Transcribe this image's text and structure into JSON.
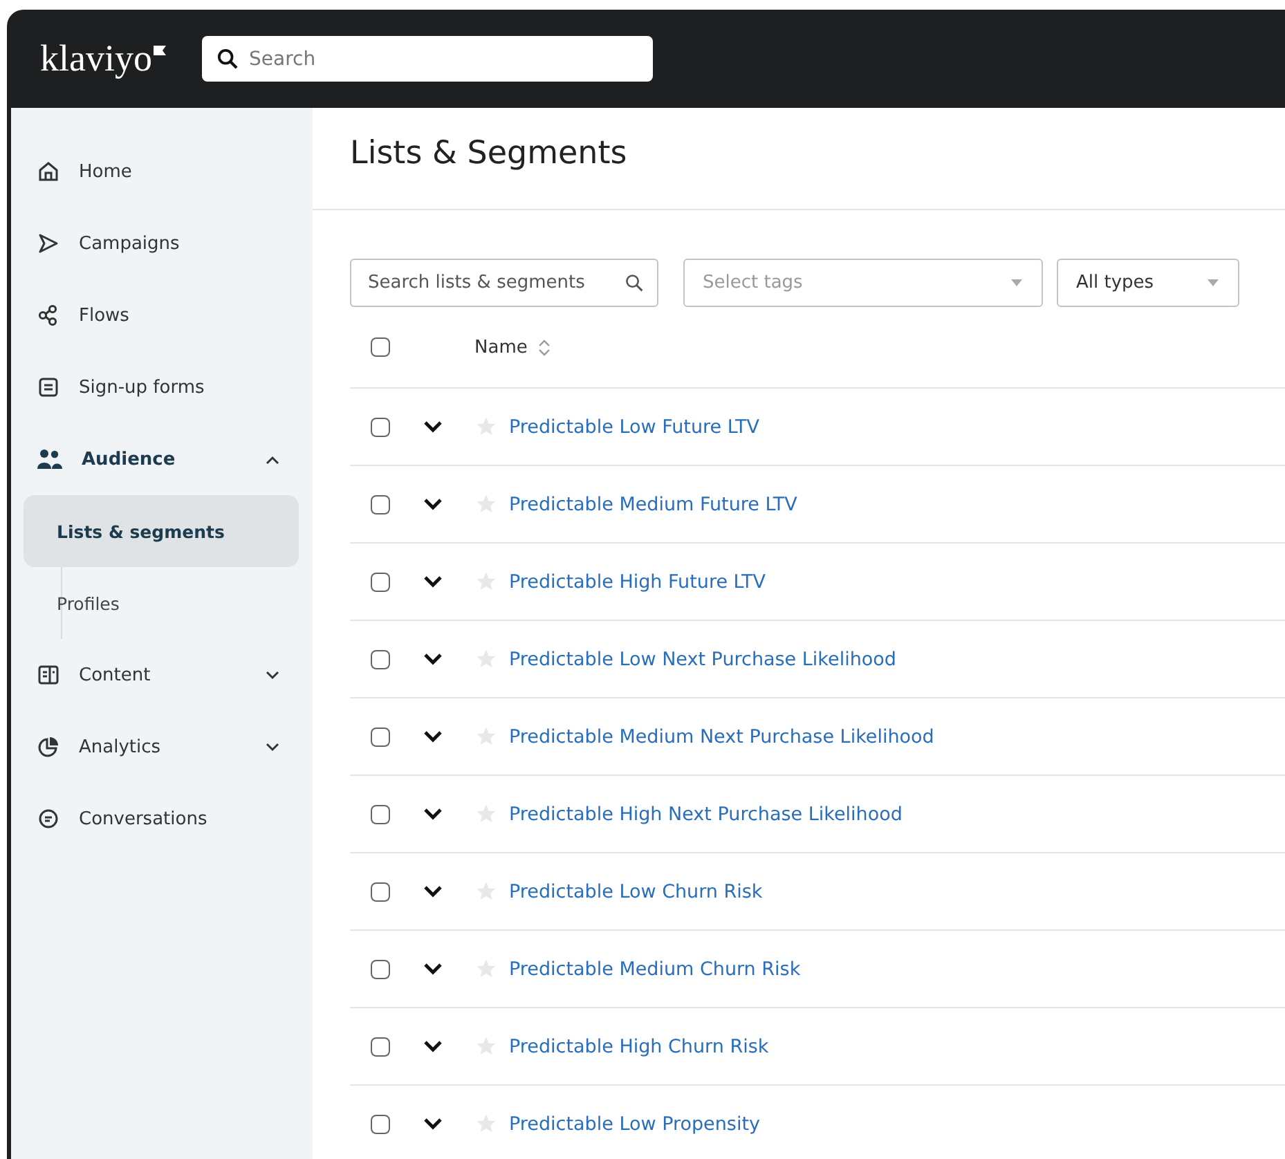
{
  "topbar": {
    "logo": "klaviyo",
    "search": {
      "placeholder": "Search"
    }
  },
  "sidebar": {
    "items": [
      {
        "label": "Home",
        "selected": false
      },
      {
        "label": "Campaigns",
        "selected": false
      },
      {
        "label": "Flows",
        "selected": false
      },
      {
        "label": "Sign-up forms",
        "selected": false
      },
      {
        "label": "Audience",
        "selected": true,
        "expanded": true,
        "children": [
          {
            "label": "Lists & segments",
            "selected": true
          },
          {
            "label": "Profiles",
            "selected": false
          }
        ]
      },
      {
        "label": "Content",
        "selected": false,
        "expanded": false
      },
      {
        "label": "Analytics",
        "selected": false,
        "expanded": false
      },
      {
        "label": "Conversations",
        "selected": false
      }
    ]
  },
  "page": {
    "title": "Lists & Segments"
  },
  "filters": {
    "search": {
      "placeholder": "Search lists & segments"
    },
    "tags": {
      "placeholder": "Select tags"
    },
    "type": {
      "value": "All types"
    }
  },
  "table": {
    "header": {
      "checked": false,
      "name": "Name"
    },
    "rows": [
      {
        "name": "Predictable Low Future LTV",
        "checked": false,
        "starred": false
      },
      {
        "name": "Predictable Medium Future LTV",
        "checked": false,
        "starred": false
      },
      {
        "name": "Predictable High Future LTV",
        "checked": false,
        "starred": false
      },
      {
        "name": "Predictable Low Next Purchase Likelihood",
        "checked": false,
        "starred": false
      },
      {
        "name": "Predictable Medium Next Purchase Likelihood",
        "checked": false,
        "starred": false
      },
      {
        "name": "Predictable High Next Purchase Likelihood",
        "checked": false,
        "starred": false
      },
      {
        "name": "Predictable Low Churn Risk",
        "checked": false,
        "starred": false
      },
      {
        "name": "Predictable Medium Churn Risk",
        "checked": false,
        "starred": false
      },
      {
        "name": "Predictable High Churn Risk",
        "checked": false,
        "starred": false
      },
      {
        "name": "Predictable Low Propensity",
        "checked": false,
        "starred": false
      }
    ]
  }
}
